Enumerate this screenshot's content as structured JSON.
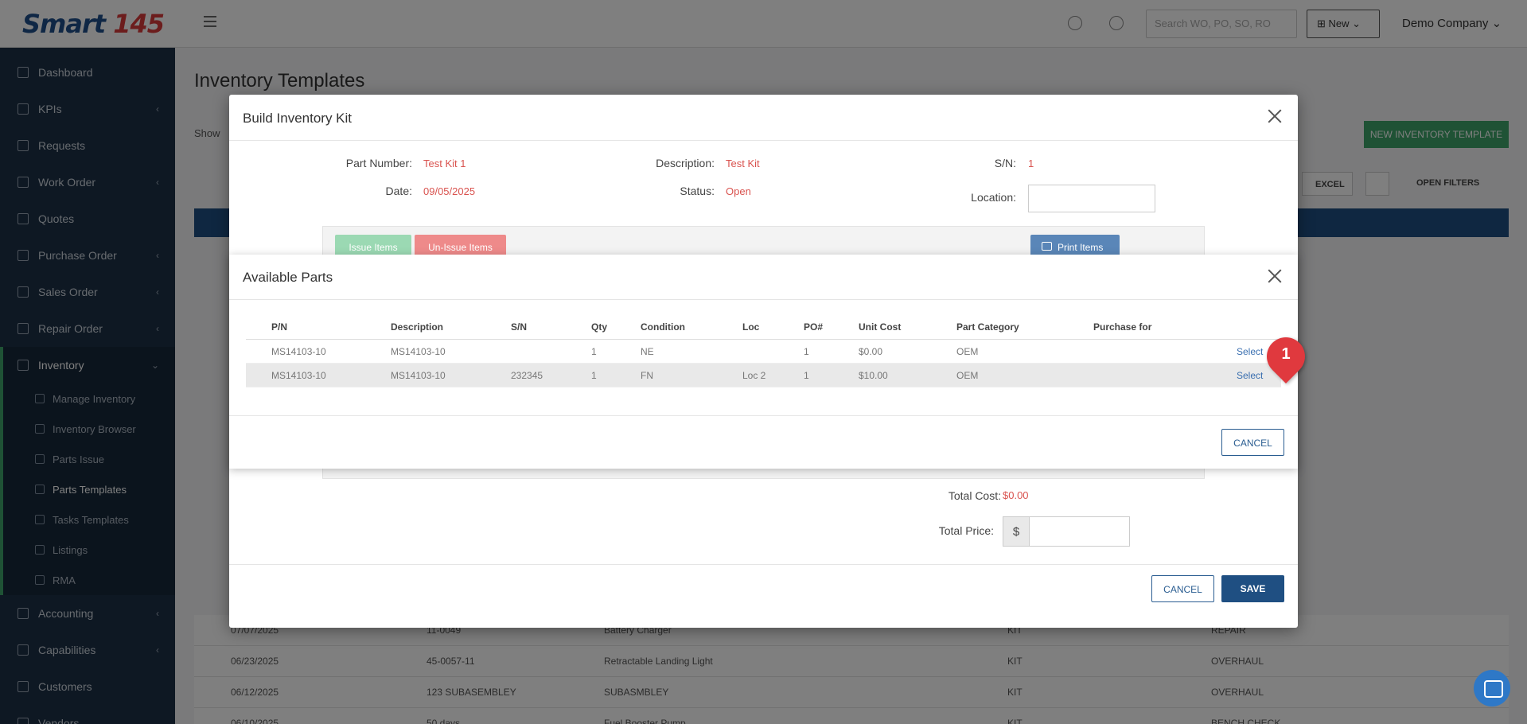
{
  "app": {
    "logo_text": "Smart",
    "logo_number": "145"
  },
  "topbar": {
    "search_placeholder": "Search WO, PO, SO, RO",
    "new_label": "New",
    "company": "Demo Company"
  },
  "sidebar": {
    "items": [
      {
        "label": "Dashboard"
      },
      {
        "label": "KPIs"
      },
      {
        "label": "Requests"
      },
      {
        "label": "Work Order"
      },
      {
        "label": "Quotes"
      },
      {
        "label": "Purchase Order"
      },
      {
        "label": "Sales Order"
      },
      {
        "label": "Repair Order"
      },
      {
        "label": "Inventory"
      },
      {
        "label": "Accounting"
      },
      {
        "label": "Capabilities"
      },
      {
        "label": "Customers"
      },
      {
        "label": "Vendors"
      }
    ],
    "inventory_sub": [
      {
        "label": "Manage Inventory"
      },
      {
        "label": "Inventory Browser"
      },
      {
        "label": "Parts Issue"
      },
      {
        "label": "Parts Templates"
      },
      {
        "label": "Tasks Templates"
      },
      {
        "label": "Listings"
      },
      {
        "label": "RMA"
      }
    ]
  },
  "page": {
    "title": "Inventory Templates",
    "show_label": "Show",
    "new_template_button": "NEW INVENTORY TEMPLATE",
    "excel_button": "EXCEL",
    "open_filters": "OPEN FILTERS",
    "rows": [
      {
        "date": "07/07/2025",
        "pn": "11-0049",
        "desc": "Battery Charger",
        "type": "KIT",
        "cat": "REPAIR"
      },
      {
        "date": "06/23/2025",
        "pn": "45-0057-11",
        "desc": "Retractable Landing Light",
        "type": "KIT",
        "cat": "OVERHAUL"
      },
      {
        "date": "06/12/2025",
        "pn": "123 SUBASEMBLEY",
        "desc": "SUBASMBLEY",
        "type": "KIT",
        "cat": "OVERHAUL"
      },
      {
        "date": "06/10/2025",
        "pn": "50 days",
        "desc": "Fuel Booster Pump",
        "type": "KIT",
        "cat": "BENCH CHECK"
      }
    ]
  },
  "build_modal": {
    "title": "Build Inventory Kit",
    "part_number_label": "Part Number:",
    "part_number": "Test Kit 1",
    "description_label": "Description:",
    "description": "Test Kit",
    "sn_label": "S/N:",
    "sn": "1",
    "date_label": "Date:",
    "date": "09/05/2025",
    "status_label": "Status:",
    "status": "Open",
    "location_label": "Location:",
    "issue_button": "Issue Items",
    "unissue_button": "Un-Issue Items",
    "print_button": "Print Items",
    "total_cost_label": "Total Cost:",
    "total_cost": "$0.00",
    "total_price_label": "Total Price:",
    "currency_symbol": "$",
    "cancel_button": "CANCEL",
    "save_button": "SAVE"
  },
  "parts_modal": {
    "title": "Available Parts",
    "columns": [
      "P/N",
      "Description",
      "S/N",
      "Qty",
      "Condition",
      "Loc",
      "PO#",
      "Unit Cost",
      "Part Category",
      "Purchase for"
    ],
    "rows": [
      {
        "pn": "MS14103-10",
        "description": "MS14103-10",
        "sn": "",
        "qty": "1",
        "condition": "NE",
        "loc": "",
        "po": "1",
        "unit_cost": "$0.00",
        "category": "OEM",
        "purchase_for": "",
        "action": "Select"
      },
      {
        "pn": "MS14103-10",
        "description": "MS14103-10",
        "sn": "232345",
        "qty": "1",
        "condition": "FN",
        "loc": "Loc 2",
        "po": "1",
        "unit_cost": "$10.00",
        "category": "OEM",
        "purchase_for": "",
        "action": "Select"
      }
    ],
    "cancel_button": "CANCEL"
  },
  "annotation": {
    "step_number": "1"
  },
  "colors": {
    "sidebar_bg": "#1c3046",
    "accent_green": "#3fa56a",
    "primary_blue": "#1f4f82",
    "value_red": "#d9534f",
    "link_blue": "#3a6fb0",
    "badge_red": "#e0393e"
  }
}
